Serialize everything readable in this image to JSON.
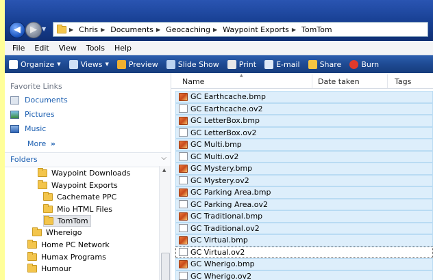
{
  "breadcrumb": [
    "Chris",
    "Documents",
    "Geocaching",
    "Waypoint Exports",
    "TomTom"
  ],
  "menu": [
    "File",
    "Edit",
    "View",
    "Tools",
    "Help"
  ],
  "toolbar": [
    {
      "label": "Organize",
      "icon": "organize-icon",
      "caret": true
    },
    {
      "label": "Views",
      "icon": "views-icon",
      "caret": true
    },
    {
      "label": "Preview",
      "icon": "preview-icon",
      "caret": false
    },
    {
      "label": "Slide Show",
      "icon": "slideshow-icon",
      "caret": false
    },
    {
      "label": "Print",
      "icon": "print-icon",
      "caret": false
    },
    {
      "label": "E-mail",
      "icon": "email-icon",
      "caret": false
    },
    {
      "label": "Share",
      "icon": "share-icon",
      "caret": false
    },
    {
      "label": "Burn",
      "icon": "burn-icon",
      "caret": false
    }
  ],
  "favorites": {
    "title": "Favorite Links",
    "items": [
      "Documents",
      "Pictures",
      "Music"
    ],
    "more": "More",
    "more_glyph": "»"
  },
  "folders": {
    "title": "Folders",
    "tree": [
      {
        "label": "Waypoint Downloads",
        "selected": false
      },
      {
        "label": "Waypoint Exports",
        "selected": false
      },
      {
        "label": "Cachemate PPC",
        "selected": false
      },
      {
        "label": "Mio HTML Files",
        "selected": false
      },
      {
        "label": "TomTom",
        "selected": true
      },
      {
        "label": "Whereigo",
        "selected": false
      },
      {
        "label": "Home PC Network",
        "selected": false
      },
      {
        "label": "Humax Programs",
        "selected": false
      },
      {
        "label": "Humour",
        "selected": false
      }
    ]
  },
  "columns": [
    "Name",
    "Date taken",
    "Tags"
  ],
  "files": [
    {
      "name": "GC Earthcache.bmp",
      "type": "bmp"
    },
    {
      "name": "GC Earthcache.ov2",
      "type": "ov2"
    },
    {
      "name": "GC LetterBox.bmp",
      "type": "bmp"
    },
    {
      "name": "GC LetterBox.ov2",
      "type": "ov2"
    },
    {
      "name": "GC Multi.bmp",
      "type": "bmp"
    },
    {
      "name": "GC Multi.ov2",
      "type": "ov2"
    },
    {
      "name": "GC Mystery.bmp",
      "type": "bmp"
    },
    {
      "name": "GC Mystery.ov2",
      "type": "ov2"
    },
    {
      "name": "GC Parking Area.bmp",
      "type": "bmp"
    },
    {
      "name": "GC Parking Area.ov2",
      "type": "ov2"
    },
    {
      "name": "GC Traditional.bmp",
      "type": "bmp"
    },
    {
      "name": "GC Traditional.ov2",
      "type": "ov2"
    },
    {
      "name": "GC Virtual.bmp",
      "type": "bmp"
    },
    {
      "name": "GC Virtual.ov2",
      "type": "ov2",
      "focused": true
    },
    {
      "name": "GC Wherigo.bmp",
      "type": "bmp"
    },
    {
      "name": "GC Wherigo.ov2",
      "type": "ov2"
    }
  ],
  "colors": {
    "frame": "#ffff99",
    "toolbar": "#1e4a93",
    "selection": "#ddeefb",
    "link": "#1c5fb1"
  }
}
